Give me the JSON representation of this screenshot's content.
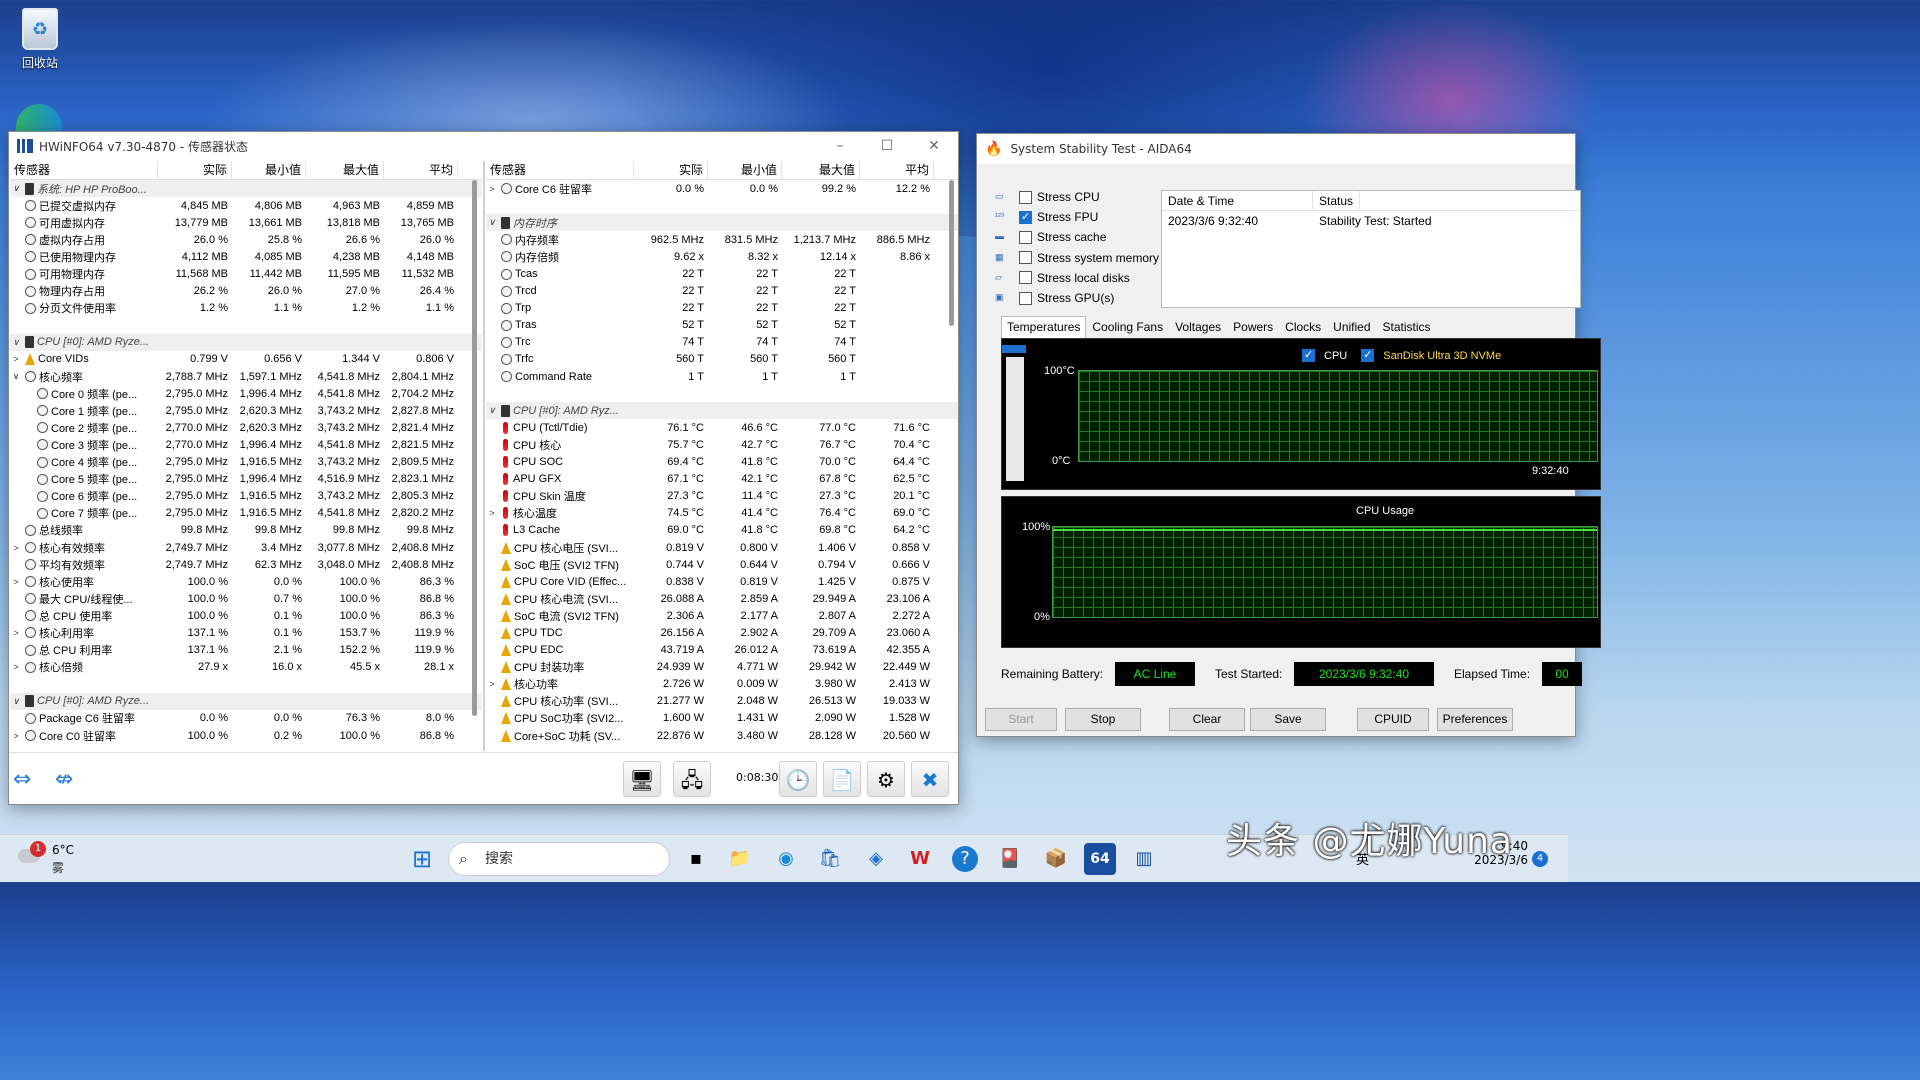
{
  "desktop": {
    "recycle_bin_label": "回收站"
  },
  "hwinfo": {
    "title": "HWiNFO64 v7.30-4870 - 传感器状态",
    "left_headers": [
      "传感器",
      "实际",
      "最小值",
      "最大值",
      "平均"
    ],
    "right_headers": [
      "传感器",
      "实际",
      "最小值",
      "最大值",
      "平均"
    ],
    "left_rows": [
      {
        "t": "grp",
        "exp": "∨",
        "ic": "chip",
        "name": "系统: HP HP ProBoo..."
      },
      {
        "ic": "clk",
        "name": "已提交虚拟内存",
        "v": [
          "4,845 MB",
          "4,806 MB",
          "4,963 MB",
          "4,859 MB"
        ]
      },
      {
        "ic": "clk",
        "name": "可用虚拟内存",
        "v": [
          "13,779 MB",
          "13,661 MB",
          "13,818 MB",
          "13,765 MB"
        ]
      },
      {
        "ic": "clk",
        "name": "虚拟内存占用",
        "v": [
          "26.0 %",
          "25.8 %",
          "26.6 %",
          "26.0 %"
        ]
      },
      {
        "ic": "clk",
        "name": "已使用物理内存",
        "v": [
          "4,112 MB",
          "4,085 MB",
          "4,238 MB",
          "4,148 MB"
        ]
      },
      {
        "ic": "clk",
        "name": "可用物理内存",
        "v": [
          "11,568 MB",
          "11,442 MB",
          "11,595 MB",
          "11,532 MB"
        ]
      },
      {
        "ic": "clk",
        "name": "物理内存占用",
        "v": [
          "26.2 %",
          "26.0 %",
          "27.0 %",
          "26.4 %"
        ]
      },
      {
        "ic": "clk",
        "name": "分页文件使用率",
        "v": [
          "1.2 %",
          "1.1 %",
          "1.2 %",
          "1.1 %"
        ]
      },
      {
        "t": "blank"
      },
      {
        "t": "grp",
        "exp": "∨",
        "ic": "chip",
        "name": "CPU [#0]: AMD Ryze..."
      },
      {
        "exp": ">",
        "ic": "bolt",
        "name": "Core VIDs",
        "v": [
          "0.799 V",
          "0.656 V",
          "1.344 V",
          "0.806 V"
        ]
      },
      {
        "exp": "∨",
        "ic": "clk",
        "name": "核心频率",
        "v": [
          "2,788.7 MHz",
          "1,597.1 MHz",
          "4,541.8 MHz",
          "2,804.1 MHz"
        ]
      },
      {
        "ind": 1,
        "ic": "clk",
        "name": "Core 0 频率 (pe...",
        "v": [
          "2,795.0 MHz",
          "1,996.4 MHz",
          "4,541.8 MHz",
          "2,704.2 MHz"
        ]
      },
      {
        "ind": 1,
        "ic": "clk",
        "name": "Core 1 频率 (pe...",
        "v": [
          "2,795.0 MHz",
          "2,620.3 MHz",
          "3,743.2 MHz",
          "2,827.8 MHz"
        ]
      },
      {
        "ind": 1,
        "ic": "clk",
        "name": "Core 2 频率 (pe...",
        "v": [
          "2,770.0 MHz",
          "2,620.3 MHz",
          "3,743.2 MHz",
          "2,821.4 MHz"
        ]
      },
      {
        "ind": 1,
        "ic": "clk",
        "name": "Core 3 频率 (pe...",
        "v": [
          "2,770.0 MHz",
          "1,996.4 MHz",
          "4,541.8 MHz",
          "2,821.5 MHz"
        ]
      },
      {
        "ind": 1,
        "ic": "clk",
        "name": "Core 4 频率 (pe...",
        "v": [
          "2,795.0 MHz",
          "1,916.5 MHz",
          "3,743.2 MHz",
          "2,809.5 MHz"
        ]
      },
      {
        "ind": 1,
        "ic": "clk",
        "name": "Core 5 频率 (pe...",
        "v": [
          "2,795.0 MHz",
          "1,996.4 MHz",
          "4,516.9 MHz",
          "2,823.1 MHz"
        ]
      },
      {
        "ind": 1,
        "ic": "clk",
        "name": "Core 6 频率 (pe...",
        "v": [
          "2,795.0 MHz",
          "1,916.5 MHz",
          "3,743.2 MHz",
          "2,805.3 MHz"
        ]
      },
      {
        "ind": 1,
        "ic": "clk",
        "name": "Core 7 频率 (pe...",
        "v": [
          "2,795.0 MHz",
          "1,916.5 MHz",
          "4,541.8 MHz",
          "2,820.2 MHz"
        ]
      },
      {
        "ic": "clk",
        "name": "总线频率",
        "v": [
          "99.8 MHz",
          "99.8 MHz",
          "99.8 MHz",
          "99.8 MHz"
        ]
      },
      {
        "exp": ">",
        "ic": "clk",
        "name": "核心有效频率",
        "v": [
          "2,749.7 MHz",
          "3.4 MHz",
          "3,077.8 MHz",
          "2,408.8 MHz"
        ]
      },
      {
        "ic": "clk",
        "name": "平均有效频率",
        "v": [
          "2,749.7 MHz",
          "62.3 MHz",
          "3,048.0 MHz",
          "2,408.8 MHz"
        ]
      },
      {
        "exp": ">",
        "ic": "clk",
        "name": "核心使用率",
        "v": [
          "100.0 %",
          "0.0 %",
          "100.0 %",
          "86.3 %"
        ]
      },
      {
        "ic": "clk",
        "name": "最大 CPU/线程使...",
        "v": [
          "100.0 %",
          "0.7 %",
          "100.0 %",
          "86.8 %"
        ]
      },
      {
        "ic": "clk",
        "name": "总 CPU 使用率",
        "v": [
          "100.0 %",
          "0.1 %",
          "100.0 %",
          "86.3 %"
        ]
      },
      {
        "exp": ">",
        "ic": "clk",
        "name": "核心利用率",
        "v": [
          "137.1 %",
          "0.1 %",
          "153.7 %",
          "119.9 %"
        ]
      },
      {
        "ic": "clk",
        "name": "总 CPU 利用率",
        "v": [
          "137.1 %",
          "2.1 %",
          "152.2 %",
          "119.9 %"
        ]
      },
      {
        "exp": ">",
        "ic": "clk",
        "name": "核心倍频",
        "v": [
          "27.9 x",
          "16.0 x",
          "45.5 x",
          "28.1 x"
        ]
      },
      {
        "t": "blank"
      },
      {
        "t": "grp",
        "exp": "∨",
        "ic": "chip",
        "name": "CPU [#0]: AMD Ryze..."
      },
      {
        "ic": "clk",
        "name": "Package C6 驻留率",
        "v": [
          "0.0 %",
          "0.0 %",
          "76.3 %",
          "8.0 %"
        ]
      },
      {
        "exp": ">",
        "ic": "clk",
        "name": "Core C0 驻留率",
        "v": [
          "100.0 %",
          "0.2 %",
          "100.0 %",
          "86.8 %"
        ]
      }
    ],
    "right_rows": [
      {
        "exp": ">",
        "ic": "clk",
        "name": "Core C6 驻留率",
        "v": [
          "0.0 %",
          "0.0 %",
          "99.2 %",
          "12.2 %"
        ]
      },
      {
        "t": "blank"
      },
      {
        "t": "grp",
        "exp": "∨",
        "ic": "chip",
        "name": "内存时序"
      },
      {
        "ic": "clk",
        "name": "内存频率",
        "v": [
          "962.5 MHz",
          "831.5 MHz",
          "1,213.7 MHz",
          "886.5 MHz"
        ]
      },
      {
        "ic": "clk",
        "name": "内存倍频",
        "v": [
          "9.62 x",
          "8.32 x",
          "12.14 x",
          "8.86 x"
        ]
      },
      {
        "ic": "clk",
        "name": "Tcas",
        "v": [
          "22 T",
          "22 T",
          "22 T",
          ""
        ]
      },
      {
        "ic": "clk",
        "name": "Trcd",
        "v": [
          "22 T",
          "22 T",
          "22 T",
          ""
        ]
      },
      {
        "ic": "clk",
        "name": "Trp",
        "v": [
          "22 T",
          "22 T",
          "22 T",
          ""
        ]
      },
      {
        "ic": "clk",
        "name": "Tras",
        "v": [
          "52 T",
          "52 T",
          "52 T",
          ""
        ]
      },
      {
        "ic": "clk",
        "name": "Trc",
        "v": [
          "74 T",
          "74 T",
          "74 T",
          ""
        ]
      },
      {
        "ic": "clk",
        "name": "Trfc",
        "v": [
          "560 T",
          "560 T",
          "560 T",
          ""
        ]
      },
      {
        "ic": "clk",
        "name": "Command Rate",
        "v": [
          "1 T",
          "1 T",
          "1 T",
          ""
        ]
      },
      {
        "t": "blank"
      },
      {
        "t": "grp",
        "exp": "∨",
        "ic": "chip",
        "name": "CPU [#0]: AMD Ryz..."
      },
      {
        "ic": "th",
        "name": "CPU (Tctl/Tdie)",
        "v": [
          "76.1 °C",
          "46.6 °C",
          "77.0 °C",
          "71.6 °C"
        ]
      },
      {
        "ic": "th",
        "name": "CPU 核心",
        "v": [
          "75.7 °C",
          "42.7 °C",
          "76.7 °C",
          "70.4 °C"
        ]
      },
      {
        "ic": "th",
        "name": "CPU SOC",
        "v": [
          "69.4 °C",
          "41.8 °C",
          "70.0 °C",
          "64.4 °C"
        ]
      },
      {
        "ic": "th",
        "name": "APU GFX",
        "v": [
          "67.1 °C",
          "42.1 °C",
          "67.8 °C",
          "62.5 °C"
        ]
      },
      {
        "ic": "th",
        "name": "CPU Skin 温度",
        "v": [
          "27.3 °C",
          "11.4 °C",
          "27.3 °C",
          "20.1 °C"
        ]
      },
      {
        "exp": ">",
        "ic": "th",
        "name": "核心温度",
        "v": [
          "74.5 °C",
          "41.4 °C",
          "76.4 °C",
          "69.0 °C"
        ]
      },
      {
        "ic": "th",
        "name": "L3 Cache",
        "v": [
          "69.0 °C",
          "41.8 °C",
          "69.8 °C",
          "64.2 °C"
        ]
      },
      {
        "ic": "bolt",
        "name": "CPU 核心电压 (SVI...",
        "v": [
          "0.819 V",
          "0.800 V",
          "1.406 V",
          "0.858 V"
        ]
      },
      {
        "ic": "bolt",
        "name": "SoC 电压 (SVI2 TFN)",
        "v": [
          "0.744 V",
          "0.644 V",
          "0.794 V",
          "0.666 V"
        ]
      },
      {
        "ic": "bolt",
        "name": "CPU Core VID (Effec...",
        "v": [
          "0.838 V",
          "0.819 V",
          "1.425 V",
          "0.875 V"
        ]
      },
      {
        "ic": "bolt",
        "name": "CPU 核心电流 (SVI...",
        "v": [
          "26.088 A",
          "2.859 A",
          "29.949 A",
          "23.106 A"
        ]
      },
      {
        "ic": "bolt",
        "name": "SoC 电流 (SVI2 TFN)",
        "v": [
          "2.306 A",
          "2.177 A",
          "2.807 A",
          "2.272 A"
        ]
      },
      {
        "ic": "bolt",
        "name": "CPU TDC",
        "v": [
          "26.156 A",
          "2.902 A",
          "29.709 A",
          "23.060 A"
        ]
      },
      {
        "ic": "bolt",
        "name": "CPU EDC",
        "v": [
          "43.719 A",
          "26.012 A",
          "73.619 A",
          "42.355 A"
        ]
      },
      {
        "ic": "bolt",
        "name": "CPU 封装功率",
        "v": [
          "24.939 W",
          "4.771 W",
          "29.942 W",
          "22.449 W"
        ]
      },
      {
        "exp": ">",
        "ic": "bolt",
        "name": "核心功率",
        "v": [
          "2.726 W",
          "0.009 W",
          "3.980 W",
          "2.413 W"
        ]
      },
      {
        "ic": "bolt",
        "name": "CPU 核心功率 (SVI...",
        "v": [
          "21.277 W",
          "2.048 W",
          "26.513 W",
          "19.033 W"
        ]
      },
      {
        "ic": "bolt",
        "name": "CPU SoC功率 (SVI2...",
        "v": [
          "1.600 W",
          "1.431 W",
          "2.090 W",
          "1.528 W"
        ]
      },
      {
        "ic": "bolt",
        "name": "Core+SoC 功耗 (SV...",
        "v": [
          "22.876 W",
          "3.480 W",
          "28.128 W",
          "20.560 W"
        ]
      }
    ],
    "timer": "0:08:30"
  },
  "aida": {
    "title": "System Stability Test - AIDA64",
    "stress": [
      {
        "label": "Stress CPU",
        "checked": false
      },
      {
        "label": "Stress FPU",
        "checked": true
      },
      {
        "label": "Stress cache",
        "checked": false
      },
      {
        "label": "Stress system memory",
        "checked": false
      },
      {
        "label": "Stress local disks",
        "checked": false
      },
      {
        "label": "Stress GPU(s)",
        "checked": false
      }
    ],
    "status_headers": [
      "Date & Time",
      "Status"
    ],
    "status_row": [
      "2023/3/6 9:32:40",
      "Stability Test: Started"
    ],
    "tabs": [
      "Temperatures",
      "Cooling Fans",
      "Voltages",
      "Powers",
      "Clocks",
      "Unified",
      "Statistics"
    ],
    "temp_graph": {
      "legend_cpu": "CPU",
      "legend_disk": "SanDisk Ultra 3D NVMe",
      "y_top": "100°C",
      "y_bottom": "0°C",
      "time": "9:32:40"
    },
    "usage_graph": {
      "title": "CPU Usage",
      "y_top": "100%",
      "y_bottom": "0%"
    },
    "remaining_battery_label": "Remaining Battery:",
    "remaining_battery": "AC Line",
    "test_started_label": "Test Started:",
    "test_started": "2023/3/6 9:32:40",
    "elapsed_label": "Elapsed Time:",
    "elapsed": "00",
    "buttons": [
      "Start",
      "Stop",
      "Clear",
      "Save",
      "CPUID",
      "Preferences"
    ]
  },
  "taskbar": {
    "weather_temp": "6°C",
    "weather_desc": "雾",
    "weather_badge": "1",
    "search": "搜索",
    "lang": "英",
    "clock_time": "9:40",
    "clock_date": "2023/3/6",
    "notif": "4"
  },
  "watermark": "头条 @尤娜Yuna"
}
